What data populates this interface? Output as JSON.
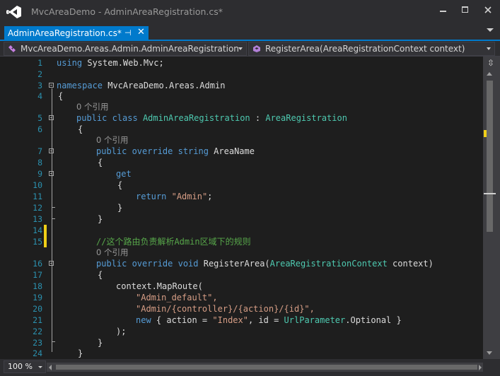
{
  "window": {
    "title": "MvcAreaDemo - AdminAreaRegistration.cs*"
  },
  "icons": {
    "app": "visual-studio-logo-icon",
    "minimize": "minimize-icon",
    "maximize": "maximize-icon",
    "close": "close-icon",
    "pin": "pin-icon",
    "tab_close": "close-icon",
    "class": "class-icon",
    "member": "method-icon",
    "split": "split-view-icon"
  },
  "tabs": [
    {
      "label": "AdminAreaRegistration.cs*",
      "active": true
    }
  ],
  "navigation": {
    "type_combo": "MvcAreaDemo.Areas.Admin.AdminAreaRegistration",
    "member_combo": "RegisterArea(AreaRegistrationContext context)"
  },
  "editor": {
    "reference_label": "0 个引用",
    "lines": [
      {
        "n": "1"
      },
      {
        "n": "2"
      },
      {
        "n": "3"
      },
      {
        "n": "4"
      },
      {
        "n": "5"
      },
      {
        "n": "6"
      },
      {
        "n": "7"
      },
      {
        "n": "8"
      },
      {
        "n": "9"
      },
      {
        "n": "10"
      },
      {
        "n": "11"
      },
      {
        "n": "12"
      },
      {
        "n": "13"
      },
      {
        "n": "14"
      },
      {
        "n": "15"
      },
      {
        "n": "16"
      },
      {
        "n": "17"
      },
      {
        "n": "18"
      },
      {
        "n": "19"
      },
      {
        "n": "20"
      },
      {
        "n": "21"
      },
      {
        "n": "22"
      },
      {
        "n": "23"
      },
      {
        "n": "24"
      }
    ],
    "code": {
      "l1": {
        "kw": "using",
        "rest": " System.Web.Mvc;"
      },
      "l3": {
        "kw": "namespace",
        "rest": " MvcAreaDemo.Areas.Admin"
      },
      "l4": "{",
      "l5": {
        "kw": "public class",
        "name": "AdminAreaRegistration",
        "sep": " : ",
        "base": "AreaRegistration"
      },
      "l6": "{",
      "l7": {
        "kw": "public override string",
        "rest": " AreaName"
      },
      "l8": "{",
      "l9": "get",
      "l10": "{",
      "l11": {
        "kw": "return",
        "str": "\"Admin\"",
        "end": ";"
      },
      "l12": "}",
      "l13": "}",
      "l15": "//这个路由负责解析Admin区域下的规则",
      "l16": {
        "kw": "public override void",
        "name": " RegisterArea(",
        "type": "AreaRegistrationContext",
        "end": " context)"
      },
      "l17": "{",
      "l18": "context.MapRoute(",
      "l19": "\"Admin_default\",",
      "l20": "\"Admin/{controller}/{action}/{id}\",",
      "l21": {
        "kw": "new",
        "a": " { action = ",
        "s": "\"Index\"",
        "b": ", id = ",
        "t": "UrlParameter",
        "c": ".Optional }"
      },
      "l22": ");",
      "l23": "}",
      "l24": "}"
    }
  },
  "statusbar": {
    "zoom": "100 %"
  }
}
